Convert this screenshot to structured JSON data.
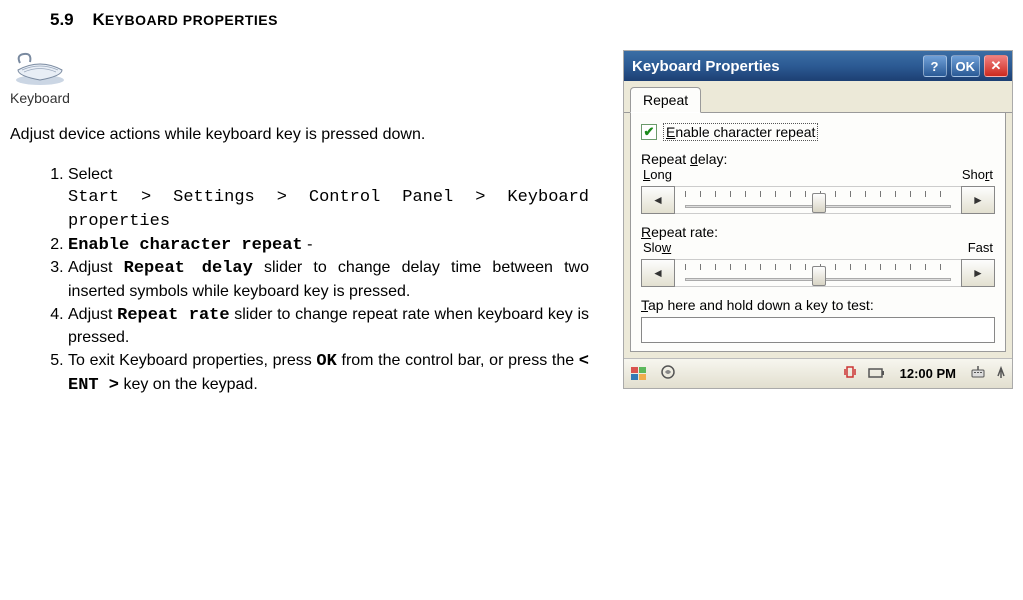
{
  "section": {
    "number": "5.9",
    "title_upper": "K",
    "title_rest": "EYBOARD PROPERTIES"
  },
  "keyboard_label": "Keyboard",
  "intro": "Adjust device actions while keyboard key is pressed down.",
  "steps": {
    "s1_prefix": "Select",
    "s1_path": "Start > Settings > Control Panel > Keyboard properties",
    "s2_bold": "Enable character repeat",
    "s2_suffix": " -",
    "s3_a": "Adjust ",
    "s3_bold": "Repeat delay",
    "s3_b": " slider to change delay time between two inserted symbols while keyboard key is pressed.",
    "s4_a": "Adjust ",
    "s4_bold": "Repeat rate",
    "s4_b": " slider to change repeat rate when keyboard key is pressed.",
    "s5_a": "To exit Keyboard properties, press ",
    "s5_bold1": "OK",
    "s5_b": " from the control bar, or press the ",
    "s5_bold2": "< ENT >",
    "s5_c": " key on the keypad."
  },
  "dialog": {
    "title": "Keyboard Properties",
    "help": "?",
    "ok": "OK",
    "close": "✕",
    "tab": "Repeat",
    "checkbox_label_pre": "E",
    "checkbox_label_rest": "nable character repeat",
    "delay_label_pre": "Repeat ",
    "delay_label_u": "d",
    "delay_label_post": "elay:",
    "delay_left": "L",
    "delay_left_rest": "ong",
    "delay_right": "Sho",
    "delay_right_u": "r",
    "delay_right_post": "t",
    "rate_label_u": "R",
    "rate_label_post": "epeat rate:",
    "rate_left": "Slo",
    "rate_left_u": "w",
    "rate_right": "Fast",
    "test_label_u": "T",
    "test_label_rest": "ap here and hold down a key to test:",
    "arrow_left": "◄",
    "arrow_right": "►"
  },
  "taskbar": {
    "clock": "12:00 PM"
  }
}
